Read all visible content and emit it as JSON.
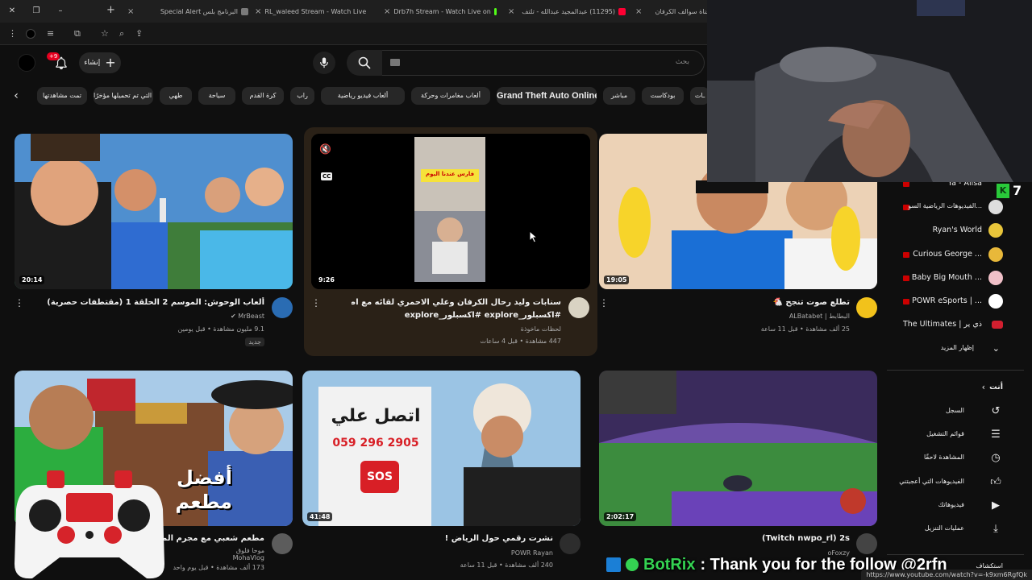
{
  "browser": {
    "tabs": [
      {
        "title": "البرنامج بلس Special Alert",
        "color": "#7a7a7a"
      },
      {
        "title": "RL_waleed Stream - Watch Live",
        "color": "#53fc18"
      },
      {
        "title": "Drb7h Stream - Watch Live on",
        "color": "#53fc18"
      },
      {
        "title": "(11295) عبدالمجيد عبدالله - تلتف",
        "color": "#ff0033"
      },
      {
        "title": "قناة سوالف الكرفان",
        "color": "#ff0033"
      }
    ],
    "tab_close": "×",
    "new_tab": "+",
    "status_url": "https://www.youtube.com/watch?v=-k9xm6RgfQk"
  },
  "masthead": {
    "notif_count": "+9",
    "create_label": "إنشاء",
    "search_placeholder": "بحث",
    "icons": [
      "microphone-icon",
      "search-icon",
      "bell-icon",
      "plus-icon"
    ]
  },
  "chips": [
    "تمت مشاهدتها",
    "الفيديوهات التي تم تحميلها مؤخرًا",
    "طهي",
    "سياحة",
    "كرة القدم",
    "راب",
    "ألعاب فيديو رياضية",
    "ألعاب مغامرات وحركة",
    "Grand Theft Auto Online",
    "مباشر",
    "بودكاست",
    "ـات"
  ],
  "videos": [
    {
      "title": "ألعاب الوحوش: الموسم 2 الحلقة 1 (مقتطفات حصرية)",
      "channel": "MrBeast",
      "views": "9.1 مليون مشاهدة • قبل يومين",
      "badge": "جديد",
      "duration": "20:14",
      "verified": "✔"
    },
    {
      "title_line1": "سنابات وليد رحال الكرفان وعلي الاحمري لقائه مع اصدقائه 😢",
      "title_line2": "#اكسبلور_explore #اكسبلور_explore",
      "channel": "لحظات ماخوذة",
      "views": "447 مشاهدة • قبل 4 ساعات",
      "duration": "9:26",
      "overlay_top": "فارس عندنا اليوم",
      "cc_label": "CC",
      "mute_icon": "🔇"
    },
    {
      "title": "تطلع صوت تنجح 🐔",
      "channel": "ALBatabet | البطابط",
      "views": "25 ألف مشاهدة • قبل 11 ساعة",
      "duration": "19:05"
    },
    {
      "title": "مطعم شعبي مع مجرم الميز باور في",
      "channel": "MohaVlog",
      "channel_extra": "موحا فلوق",
      "views": "173 ألف مشاهدة • قبل يوم واحد",
      "duration": "",
      "thumb_text": "أفضل مطعم"
    },
    {
      "title": "نشرت رقمي حول الرياض !",
      "channel": "POWR Rayan",
      "views": "240 ألف مشاهدة • قبل 11 ساعة",
      "duration": "41:48",
      "sign_title": "اتصل علي",
      "sign_number": "059 296 2905",
      "sign_sos": "SOS"
    },
    {
      "title": "(Twitch nwpo_rl) 2s",
      "channel": "oFoxzy",
      "views": "",
      "duration": "2:02:17"
    }
  ],
  "sidebar": {
    "subscriptions": [
      {
        "name": "Ya - Alisa",
        "color": "#888888"
      },
      {
        "name": "الفيديوهات الرياضية السو...",
        "color": "#dddddd"
      },
      {
        "name": "Ryan's World",
        "color": "#e8c53a"
      },
      {
        "name": "Curious George ...",
        "color": "#e8b83a"
      },
      {
        "name": "Baby Big Mouth ...",
        "color": "#f0c0c8"
      },
      {
        "name": "POWR eSports | ...",
        "color": "#ffffff"
      },
      {
        "name": "The Ultimates | ذي ير",
        "color": "#d21f2f"
      }
    ],
    "show_more": "إظهار المزيد",
    "you_label": "أنت",
    "nav": [
      {
        "label": "السجل",
        "icon": "history-icon"
      },
      {
        "label": "قوائم التشغيل",
        "icon": "playlists-icon"
      },
      {
        "label": "المشاهدة لاحقًا",
        "icon": "watch-later-icon"
      },
      {
        "label": "الفيديوهات التي أعجبتني",
        "icon": "like-icon"
      },
      {
        "label": "فيديوهاتك",
        "icon": "your-videos-icon"
      },
      {
        "label": "عمليات التنزيل",
        "icon": "download-icon"
      }
    ],
    "explore_label": "استكشاف"
  },
  "overlay": {
    "bot_name": "BotRix",
    "bot_message": ": Thank you for the follow @2rfn",
    "seven_count": "7",
    "seven_k": "K"
  },
  "colors": {
    "background": "#0f0f0f",
    "accent_red": "#ff0033",
    "kick_green": "#53fc18",
    "botrix_green": "#34d352"
  }
}
